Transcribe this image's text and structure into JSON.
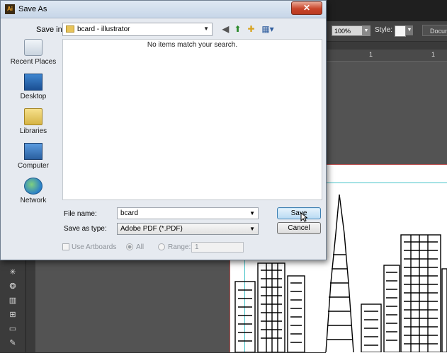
{
  "dialog": {
    "title": "Save As",
    "app_logo": "Ai",
    "close_label": "✕",
    "save_in_label": "Save in:",
    "save_in_value": "bcard - illustrator",
    "empty_message": "No items match your search.",
    "places": [
      {
        "label": "Recent Places",
        "icon": "recent-places-icon"
      },
      {
        "label": "Desktop",
        "icon": "desktop-icon"
      },
      {
        "label": "Libraries",
        "icon": "libraries-icon"
      },
      {
        "label": "Computer",
        "icon": "computer-icon"
      },
      {
        "label": "Network",
        "icon": "network-icon"
      }
    ],
    "file_name_label": "File name:",
    "file_name_value": "bcard",
    "save_as_type_label": "Save as type:",
    "save_as_type_value": "Adobe PDF (*.PDF)",
    "save_button": "Save",
    "cancel_button": "Cancel",
    "use_artboards_label": "Use Artboards",
    "all_label": "All",
    "range_label": "Range:",
    "range_value": "1"
  },
  "app": {
    "zoom_value": "100%",
    "style_label": "Style:",
    "document_button": "Docum",
    "ruler_numbers": [
      "1",
      "1"
    ]
  },
  "colors": {
    "dialog_bg": "#e6eaf0",
    "close_button": "#c9452a",
    "save_button_border": "#3c7fb1",
    "artboard_border": "#b84a4a",
    "guide": "#47c3c9",
    "app_bg": "#535353"
  }
}
